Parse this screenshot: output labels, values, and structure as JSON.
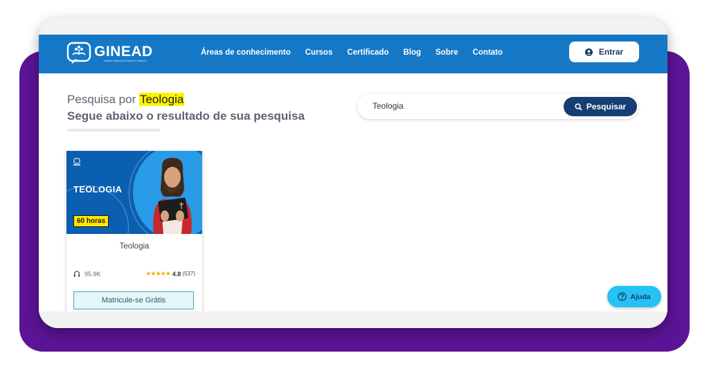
{
  "brand": {
    "name": "GINEAD",
    "tagline": "Instituto Nacional de Ensino a Distância",
    "color_primary": "#1578c6",
    "color_dark": "#163e73",
    "color_purple": "#5b1495"
  },
  "nav": {
    "links": [
      "Áreas de conhecimento",
      "Cursos",
      "Certificado",
      "Blog",
      "Sobre",
      "Contato"
    ],
    "login_label": "Entrar"
  },
  "search": {
    "title_prefix": "Pesquisa por",
    "term": "Teologia",
    "subtitle": "Segue abaixo o resultado de sua pesquisa",
    "input_value": "Teologia",
    "button_label": "Pesquisar"
  },
  "results": [
    {
      "image_title": "TEOLOGIA",
      "hours_badge": "60 horas",
      "title": "Teologia",
      "views": "95.9K",
      "stars": "★★★★★",
      "rating": "4.8",
      "rating_count": "(537)",
      "cta": "Matricule-se Grátis"
    }
  ],
  "help": {
    "label": "Ajuda"
  }
}
